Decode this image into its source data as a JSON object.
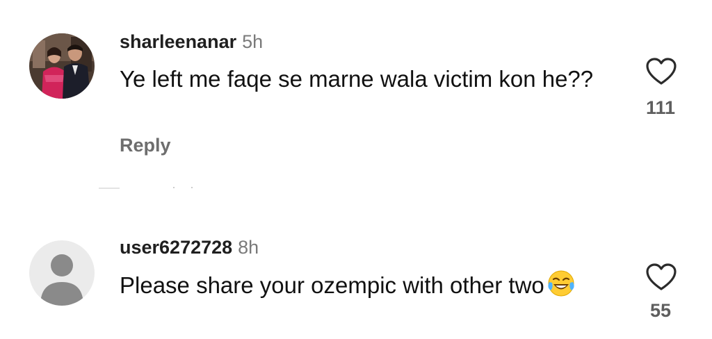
{
  "comments": [
    {
      "username": "sharleenanar",
      "time": "5h",
      "text": "Ye left me faqe se marne wala victim kon he??",
      "reply_label": "Reply",
      "likes": "111",
      "avatar": "photo-avatar"
    },
    {
      "username": "user6272728",
      "time": "8h",
      "text": "Please share your ozempic with other two",
      "emoji": "face-with-tears-of-joy-icon",
      "likes": "55",
      "avatar": "default-avatar"
    }
  ],
  "colors": {
    "like_outline": "#2b2b2b",
    "default_avatar_bg": "#ebebeb",
    "default_avatar_fg": "#8a8a8a"
  }
}
